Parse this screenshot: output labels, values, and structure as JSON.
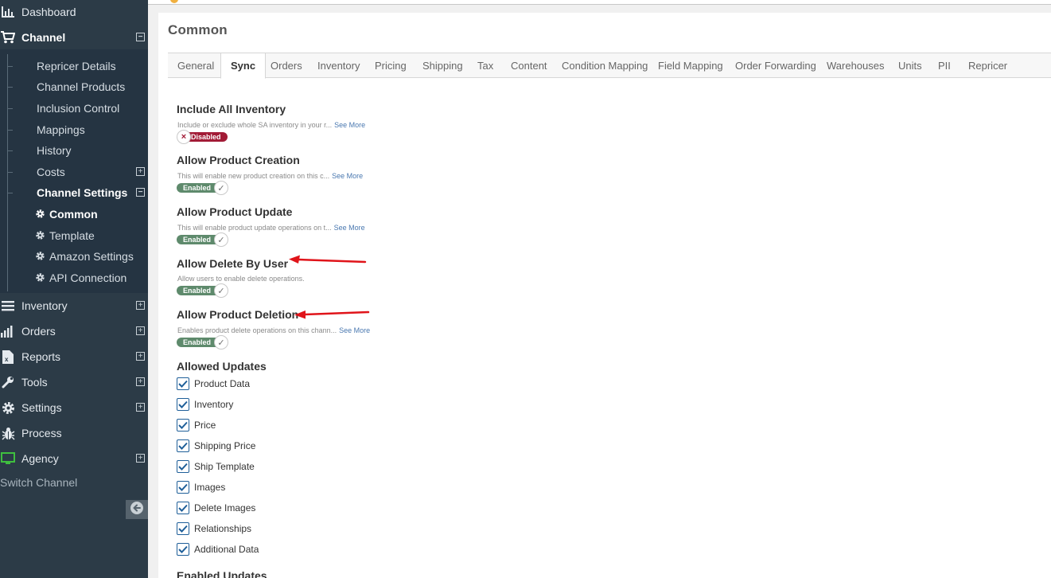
{
  "sidebar": {
    "dashboard": "Dashboard",
    "channel": "Channel",
    "channel_sub": [
      "Repricer Details",
      "Channel Products",
      "Inclusion Control",
      "Mappings",
      "History",
      "Costs",
      "Channel Settings"
    ],
    "settings_sub": [
      "Common",
      "Template",
      "Amazon Settings",
      "API Connection"
    ],
    "bottom": [
      "Inventory",
      "Orders",
      "Reports",
      "Tools",
      "Settings",
      "Process",
      "Agency"
    ],
    "switch_channel": "Switch Channel"
  },
  "page": {
    "title": "Common",
    "tabs": [
      "General",
      "Sync",
      "Orders",
      "Inventory",
      "Pricing",
      "Shipping",
      "Tax",
      "Content",
      "Condition Mapping",
      "Field Mapping",
      "Order Forwarding",
      "Warehouses",
      "Units",
      "PII",
      "Repricer"
    ],
    "active_tab": "Sync"
  },
  "settings": [
    {
      "title": "Include All Inventory",
      "desc": "Include or exclude whole SA inventory in your r...",
      "more": "See More",
      "state": "Disabled"
    },
    {
      "title": "Allow Product Creation",
      "desc": "This will enable new product creation on this c...",
      "more": "See More",
      "state": "Enabled"
    },
    {
      "title": "Allow Product Update",
      "desc": "This will enable product update operations on t...",
      "more": "See More",
      "state": "Enabled"
    },
    {
      "title": "Allow Delete By User",
      "desc": "Allow users to enable delete operations.",
      "more": "",
      "state": "Enabled"
    },
    {
      "title": "Allow Product Deletion",
      "desc": "Enables product delete operations on this chann...",
      "more": "See More",
      "state": "Enabled"
    }
  ],
  "allowed_updates": {
    "title": "Allowed Updates",
    "items": [
      "Product Data",
      "Inventory",
      "Price",
      "Shipping Price",
      "Ship Template",
      "Images",
      "Delete Images",
      "Relationships",
      "Additional Data"
    ]
  },
  "enabled_updates": {
    "title": "Enabled Updates"
  },
  "colors": {
    "sidebar": "#2c3b47",
    "enabled": "#5e8a6c",
    "disabled": "#a21b36",
    "checkbox": "#1f5f99",
    "arrow": "#e0141a"
  },
  "icons": [
    "dashboard-icon",
    "cart-icon",
    "gear-icon",
    "list-icon",
    "bar-chart-icon",
    "excel-icon",
    "wrench-icon",
    "bug-icon",
    "monitor-icon",
    "back-arrow-icon",
    "check-icon",
    "close-icon"
  ]
}
